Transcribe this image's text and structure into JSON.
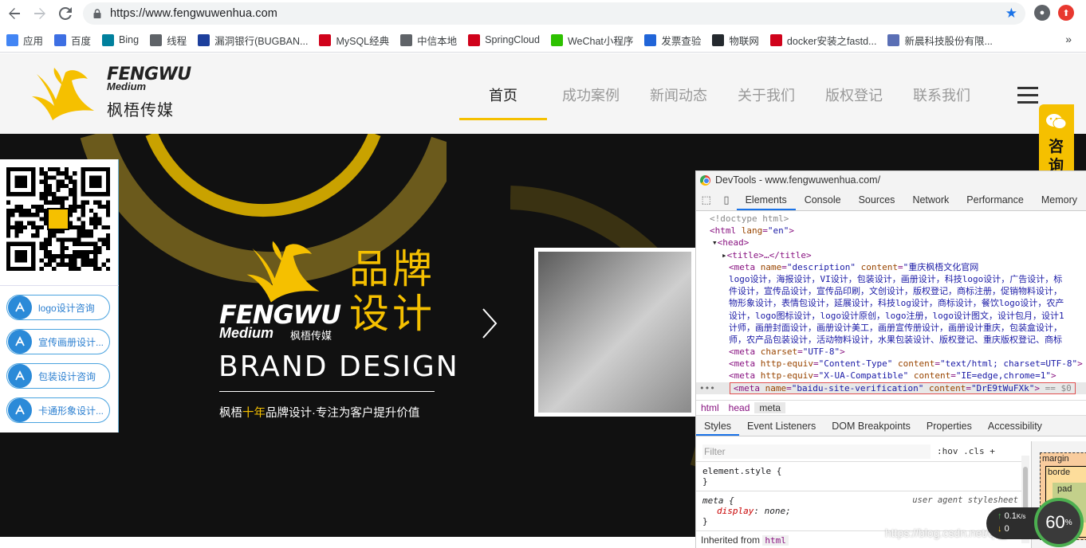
{
  "browser": {
    "url": "https://www.fengwuwenhua.com",
    "bookmarks": [
      {
        "label": "应用",
        "color": "#4285f4"
      },
      {
        "label": "百度",
        "color": "#3d6fe3"
      },
      {
        "label": "Bing",
        "color": "#00809d"
      },
      {
        "label": "线程",
        "color": "#5f6368"
      },
      {
        "label": "漏洞银行(BUGBAN...",
        "color": "#1d3f9c"
      },
      {
        "label": "MySQL经典",
        "color": "#d0021b"
      },
      {
        "label": "中信本地",
        "color": "#5f6368"
      },
      {
        "label": "SpringCloud",
        "color": "#d0021b"
      },
      {
        "label": "WeChat小程序",
        "color": "#2dc100"
      },
      {
        "label": "发票查验",
        "color": "#2165d8"
      },
      {
        "label": "物联网",
        "color": "#24292e"
      },
      {
        "label": "docker安装之fastd...",
        "color": "#d0021b"
      },
      {
        "label": "新晨科技股份有限...",
        "color": "#5a6fb5"
      }
    ],
    "more": "»"
  },
  "site": {
    "brand_en": "FENGWU",
    "brand_medium": "Medium",
    "brand_cn": "枫梧传媒",
    "nav": [
      {
        "label": "首页",
        "active": true
      },
      {
        "label": "成功案例",
        "active": false
      },
      {
        "label": "新闻动态",
        "active": false
      },
      {
        "label": "关于我们",
        "active": false
      },
      {
        "label": "版权登记",
        "active": false
      },
      {
        "label": "联系我们",
        "active": false
      }
    ],
    "hero": {
      "title_line1": "品牌",
      "title_line2": "设计",
      "logo_en": "FENGWU",
      "logo_medium": "Medium",
      "logo_cn": "枫梧传媒",
      "brand_design": "BRAND DESIGN",
      "slogan_pre": "枫梧",
      "slogan_hl": "十年",
      "slogan_post": "品牌设计·专注为客户提升价值"
    },
    "consult_buttons": [
      "logo设计咨询",
      "宣传画册设计...",
      "包装设计咨询",
      "卡通形象设计..."
    ],
    "side_tab": "咨询"
  },
  "devtools": {
    "title": "DevTools - www.fengwuwenhua.com/",
    "tabs": [
      "Elements",
      "Console",
      "Sources",
      "Network",
      "Performance",
      "Memory"
    ],
    "active_tab": "Elements",
    "code": {
      "doctype": "<!doctype html>",
      "html_open": "<html",
      "lang_attr": "lang",
      "lang_val": "\"en\"",
      "head_open": "<head>",
      "title_line": "<title>…</title>",
      "meta1_attrs": [
        "name",
        "\"description\"",
        "content",
        "\"重庆枫梧文化官网"
      ],
      "meta1_content": [
        "logo设计，海报设计，VI设计，包装设计，画册设计，科技logo设计，广告设计，标",
        "件设计，宣传品设计，宣传品印刷，文创设计，版权登记，商标注册，促销物料设计，",
        "物形象设计，表情包设计，延展设计，科技log设计，商标设计，餐饮logo设计，农产",
        "设计，logo图标设计，logo设计原创，logo注册，logo设计图文，设计包月，设计1",
        "计师，画册封面设计，画册设计美工，画册宣传册设计，画册设计重庆，包装盒设计，",
        "师，农产品包装设计，活动物料设计，水果包装设计、版权登记、重庆版权登记、商标"
      ],
      "meta2": [
        "charset",
        "\"UTF-8\""
      ],
      "meta3": [
        "http-equiv",
        "\"Content-Type\"",
        "content",
        "\"text/html; charset=UTF-8\""
      ],
      "meta4": [
        "http-equiv",
        "\"X-UA-Compatible\"",
        "content",
        "\"IE=edge,chrome=1\""
      ],
      "meta5": [
        "name",
        "\"baidu-site-verification\"",
        "content",
        "\"DrE9tWuFXk\""
      ],
      "selected_suffix": "== $0"
    },
    "breadcrumbs": [
      "html",
      "head",
      "meta"
    ],
    "styles_tabs": [
      "Styles",
      "Event Listeners",
      "DOM Breakpoints",
      "Properties",
      "Accessibility"
    ],
    "filter_placeholder": "Filter",
    "filter_tools": ":hov  .cls  +",
    "rule1_selector": "element.style {",
    "rule1_close": "}",
    "rule2_selector": "meta {",
    "rule2_source": "user agent stylesheet",
    "rule2_prop": "display",
    "rule2_val": "none;",
    "rule2_close": "}",
    "inherited_label": "Inherited from",
    "inherited_tag": "html",
    "box_margin": "margin",
    "box_border": "borde",
    "box_padding": "pad"
  },
  "widget": {
    "speed_up": "0.1",
    "speed_up_unit": "K/s",
    "speed_down": "0",
    "percent": "60",
    "percent_unit": "%"
  },
  "watermark": "https://blog.csdn.net/qq_40016949"
}
